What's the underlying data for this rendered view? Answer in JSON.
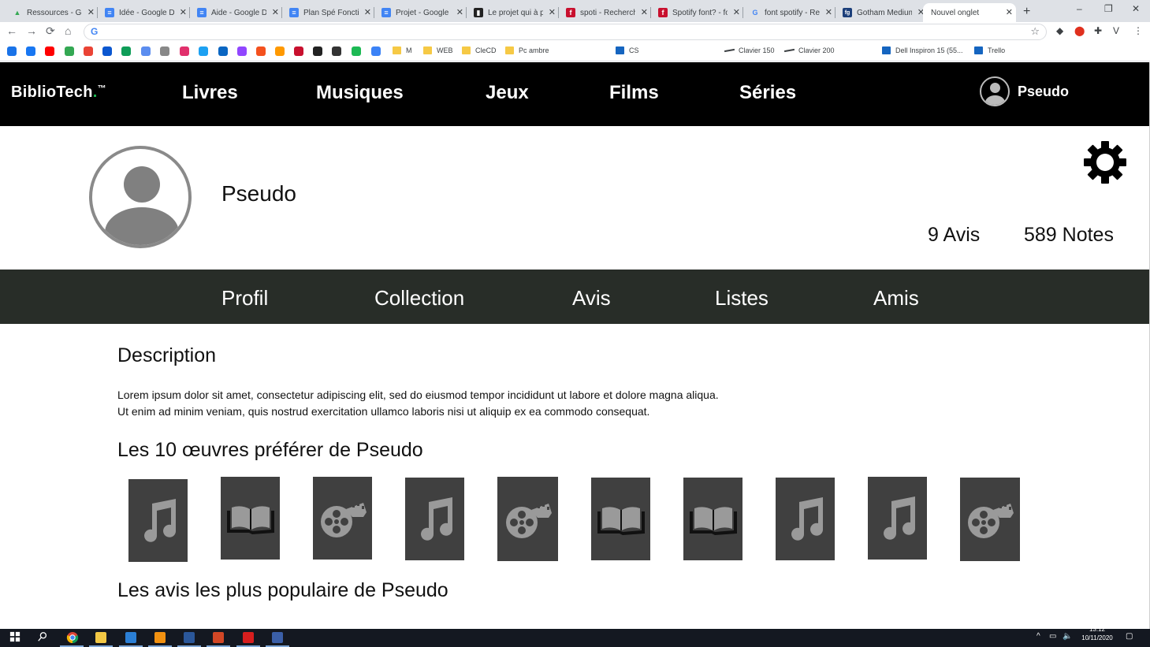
{
  "browser": {
    "tabs": [
      {
        "label": "Ressources - Goo",
        "color": "#34a853",
        "glyph": "▲",
        "close": "✕"
      },
      {
        "label": "Idée - Google Do",
        "color": "#4285f4",
        "glyph": "≡",
        "close": "✕"
      },
      {
        "label": "Aide - Google Do",
        "color": "#4285f4",
        "glyph": "≡",
        "close": "✕"
      },
      {
        "label": "Plan Spé Fonctio",
        "color": "#4285f4",
        "glyph": "≡",
        "close": "✕"
      },
      {
        "label": "Projet - Google D",
        "color": "#4285f4",
        "glyph": "≡",
        "close": "✕"
      },
      {
        "label": "Le projet qui à p",
        "color": "#222222",
        "glyph": "▮",
        "close": "✕"
      },
      {
        "label": "spoti - Recherch",
        "color": "#c8102e",
        "glyph": "f",
        "close": "✕"
      },
      {
        "label": "Spotify font? - fo",
        "color": "#c8102e",
        "glyph": "f",
        "close": "✕"
      },
      {
        "label": "font spotify - Rec",
        "color": "#ffffff",
        "glyph": "G",
        "close": "✕"
      },
      {
        "label": "Gotham Medium",
        "color": "#1c3f7a",
        "glyph": "fg",
        "close": "✕"
      },
      {
        "label": "Nouvel onglet",
        "color": "",
        "glyph": "",
        "close": "✕"
      }
    ],
    "new_tab": "+",
    "window_controls": {
      "minimize": "–",
      "restore": "❐",
      "close": "✕"
    },
    "nav": {
      "back": "←",
      "forward": "→",
      "reload": "⟳",
      "home": "⌂"
    },
    "omnibox_value": "",
    "omnibox_icon": "G",
    "bookmark_star": "☆",
    "extensions": [
      "◆",
      "⬤",
      "✚",
      "V",
      "⋮"
    ],
    "bookmarks_icons": [
      "#1a73e8",
      "#1877f2",
      "#ff0000",
      "#34a853",
      "#ea4335",
      "#0b57d0",
      "#0f9d58",
      "#5b8def",
      "#888888",
      "#e1306c",
      "#1da1f2",
      "#0a66c2",
      "#9146ff",
      "#f4511e",
      "#ff9900",
      "#c8102e",
      "#222222",
      "#333333",
      "#1db954",
      "#3b82f6"
    ],
    "bookmarks_text": [
      {
        "label": "M",
        "kind": "folder"
      },
      {
        "label": "WEB",
        "kind": "folder"
      },
      {
        "label": "CleCD",
        "kind": "folder"
      },
      {
        "label": "Pc ambre",
        "kind": "folder"
      },
      {
        "label": "CS",
        "kind": "icon"
      },
      {
        "label": "Clavier 150",
        "kind": "dash"
      },
      {
        "label": "Clavier 200",
        "kind": "dash"
      },
      {
        "label": "Dell Inspiron 15 (55...",
        "kind": "icon"
      },
      {
        "label": "Trello",
        "kind": "icon"
      }
    ]
  },
  "site": {
    "brand": {
      "name": "BiblioTech",
      "dot": ".",
      "tm": "™"
    },
    "nav": [
      "Livres",
      "Musiques",
      "Jeux",
      "Films",
      "Séries"
    ],
    "user": {
      "name": "Pseudo"
    }
  },
  "profile": {
    "name": "Pseudo",
    "stats": {
      "avis": "9 Avis",
      "notes": "589 Notes"
    },
    "tabs": [
      "Profil",
      "Collection",
      "Avis",
      "Listes",
      "Amis"
    ]
  },
  "content": {
    "description_title": "Description",
    "description_lines": [
      "Lorem ipsum dolor sit amet, consectetur adipiscing elit, sed do eiusmod tempor incididunt ut labore et dolore magna aliqua.",
      "Ut enim ad minim veniam, quis nostrud exercitation ullamco laboris nisi ut aliquip ex ea commodo consequat."
    ],
    "favorites_title": "Les 10 œuvres préférer de Pseudo",
    "favorites": [
      "music-icon",
      "book-icon",
      "film-icon",
      "music-icon",
      "film-icon",
      "book-icon",
      "book-icon",
      "music-icon",
      "music-icon",
      "film-icon"
    ],
    "popular_title": "Les avis les plus populaire de Pseudo"
  },
  "taskbar": {
    "time": "13:12",
    "date": "10/11/2020",
    "apps": [
      "start-icon",
      "search-icon",
      "chrome-icon",
      "explorer-icon",
      "calculator-icon",
      "sublime-icon",
      "word-icon",
      "document-icon",
      "acrobat-icon",
      "image-editor-icon"
    ],
    "tray": [
      "^",
      "▭",
      "🔈",
      "▢"
    ]
  }
}
